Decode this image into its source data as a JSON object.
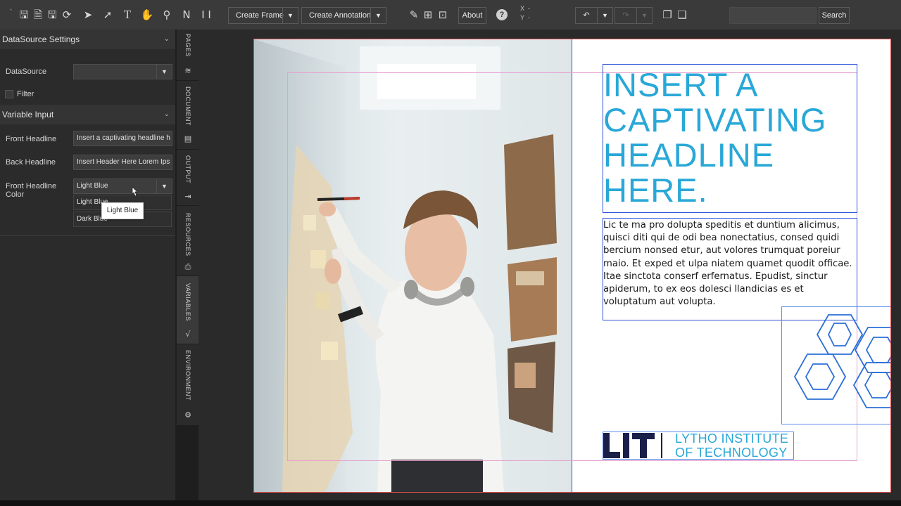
{
  "toolbar": {
    "create_frame": "Create Frame",
    "create_annotation": "Create Annotation",
    "about": "About",
    "x_label": "X",
    "x_value": "-",
    "y_label": "Y",
    "y_value": "-",
    "search_button": "Search",
    "search_value": ""
  },
  "left_panel": {
    "datasource_section": "DataSource Settings",
    "datasource_label": "DataSource",
    "datasource_value": "",
    "filter_label": "Filter",
    "variable_section": "Variable Input",
    "front_headline_label": "Front Headline",
    "front_headline_value": "Insert a captivating headline h",
    "back_headline_label": "Back Headline",
    "back_headline_value": "Insert Header Here Lorem Ips",
    "front_color_label_1": "Front Headline",
    "front_color_label_2": "Color",
    "front_color_value": "Light Blue",
    "options": [
      "Light Blue",
      "Dark Blue"
    ],
    "tooltip": "Light Blue"
  },
  "vertical_tabs": [
    "PAGES",
    "DOCUMENT",
    "OUTPUT",
    "RESOURCES",
    "VARIABLES",
    "ENVIRONMENT"
  ],
  "document": {
    "headline_lines": [
      "INSERT A",
      "CAPTIVATING",
      "HEADLINE",
      "HERE."
    ],
    "body": "Lic te ma pro dolupta speditis et duntium alicimus, quisci diti qui de odi bea nonectatius, consed quidi bercium nonsed etur, aut volores trumquat poreiur maio. Et exped et ulpa niatem quamet quodit officae. Itae sinctota conserf erfernatus. Epudist, sinctur apiderum, to ex eos dolesci llandicias es et voluptatum aut volupta.",
    "logo_mark": "LIT",
    "logo_line1": "LYTHO INSTITUTE",
    "logo_line2": "OF TECHNOLOGY"
  },
  "colors": {
    "headline": "#29a8d8",
    "frame_outline": "#2b50d8",
    "logo_dark": "#1a1f4a"
  },
  "icons": [
    "save-icon",
    "save-as-icon",
    "save-all-icon",
    "refresh-icon",
    "pointer-icon",
    "direct-select-icon",
    "text-tool-icon",
    "hand-icon",
    "zoom-icon",
    "node-icon",
    "column-icon",
    "help-icon",
    "undo-icon",
    "redo-icon",
    "pages-icon"
  ]
}
